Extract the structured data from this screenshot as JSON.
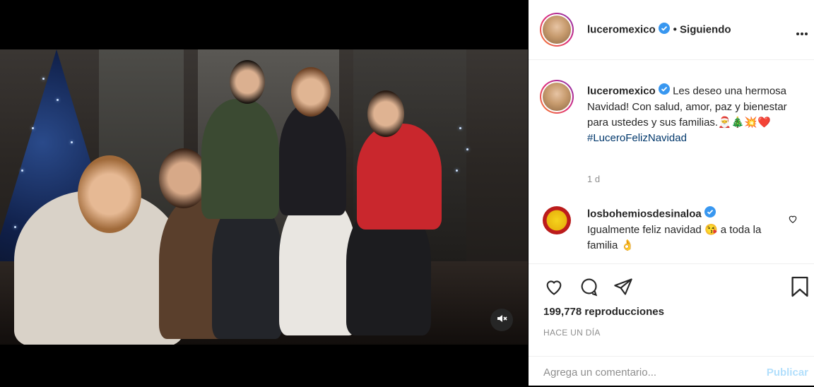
{
  "post": {
    "username": "luceromexico",
    "follow_status": "• Siguiendo",
    "caption_text": "Les deseo una hermosa Navidad! Con salud, amor, paz y bienestar para ustedes y sus familias.🎅🎄💥❤️",
    "hashtag": "#LuceroFelizNavidad",
    "caption_time": "1 d"
  },
  "comment": {
    "username": "losbohemiosdesinaloa",
    "text": "Igualmente feliz navidad 😘 a toda la familia 👌"
  },
  "stats": {
    "views": "199,778 reproducciones",
    "posted_ago": "HACE UN DÍA"
  },
  "comment_box": {
    "placeholder": "Agrega un comentario...",
    "publish_label": "Publicar"
  },
  "colors": {
    "verified": "#3897f0",
    "publish_disabled": "#b2dffc",
    "hashtag": "#00376b"
  },
  "icons": [
    "more-options-icon",
    "verified-icon",
    "heart-icon",
    "comment-icon",
    "share-icon",
    "bookmark-icon",
    "mute-icon",
    "like-comment-icon"
  ]
}
